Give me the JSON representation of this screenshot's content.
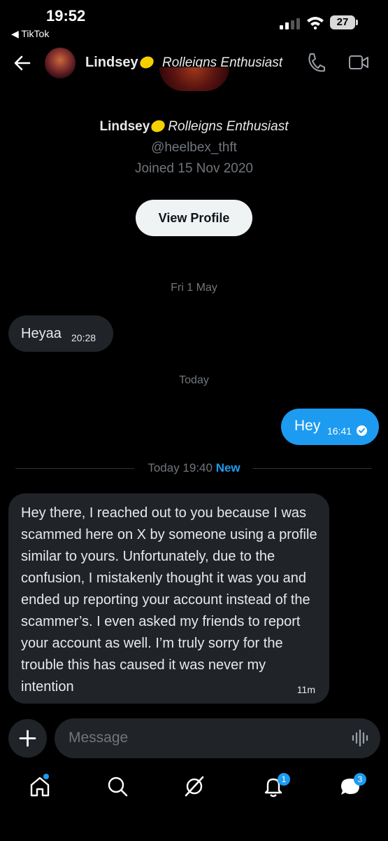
{
  "status_bar": {
    "time": "19:52",
    "back_app": "◀ TikTok",
    "battery": "27"
  },
  "header": {
    "name": "Lindsey",
    "bio": "Rolleigns Enthusiast"
  },
  "profile": {
    "name": "Lindsey",
    "bio": "Rolleigns Enthusiast",
    "handle": "@heelbex_thft",
    "joined": "Joined 15 Nov 2020",
    "view_profile": "View Profile"
  },
  "messages": [
    {
      "date": "Fri 1 May",
      "text": "Heyaa",
      "time": "20:28",
      "direction": "incoming"
    },
    {
      "date": "Today",
      "text": "Hey",
      "time": "16:41",
      "direction": "outgoing"
    }
  ],
  "new_divider": {
    "label": "Today 19:40",
    "tag": "New"
  },
  "long_message": {
    "text": "Hey there, I reached out to you because I was scammed here on X by someone using a profile similar to yours. Unfortunately, due to the confusion, I mistakenly thought it was you and ended up reporting your account instead of the scammer’s. I even asked my friends to report your account as well. I’m truly sorry for the trouble this has caused it was never my intention",
    "time": "11m"
  },
  "composer": {
    "placeholder": "Message"
  },
  "nav": {
    "notifications_badge": "1",
    "messages_badge": "3"
  },
  "colors": {
    "accent": "#1d9bf0",
    "background": "#000000",
    "bubble": "#202327"
  }
}
